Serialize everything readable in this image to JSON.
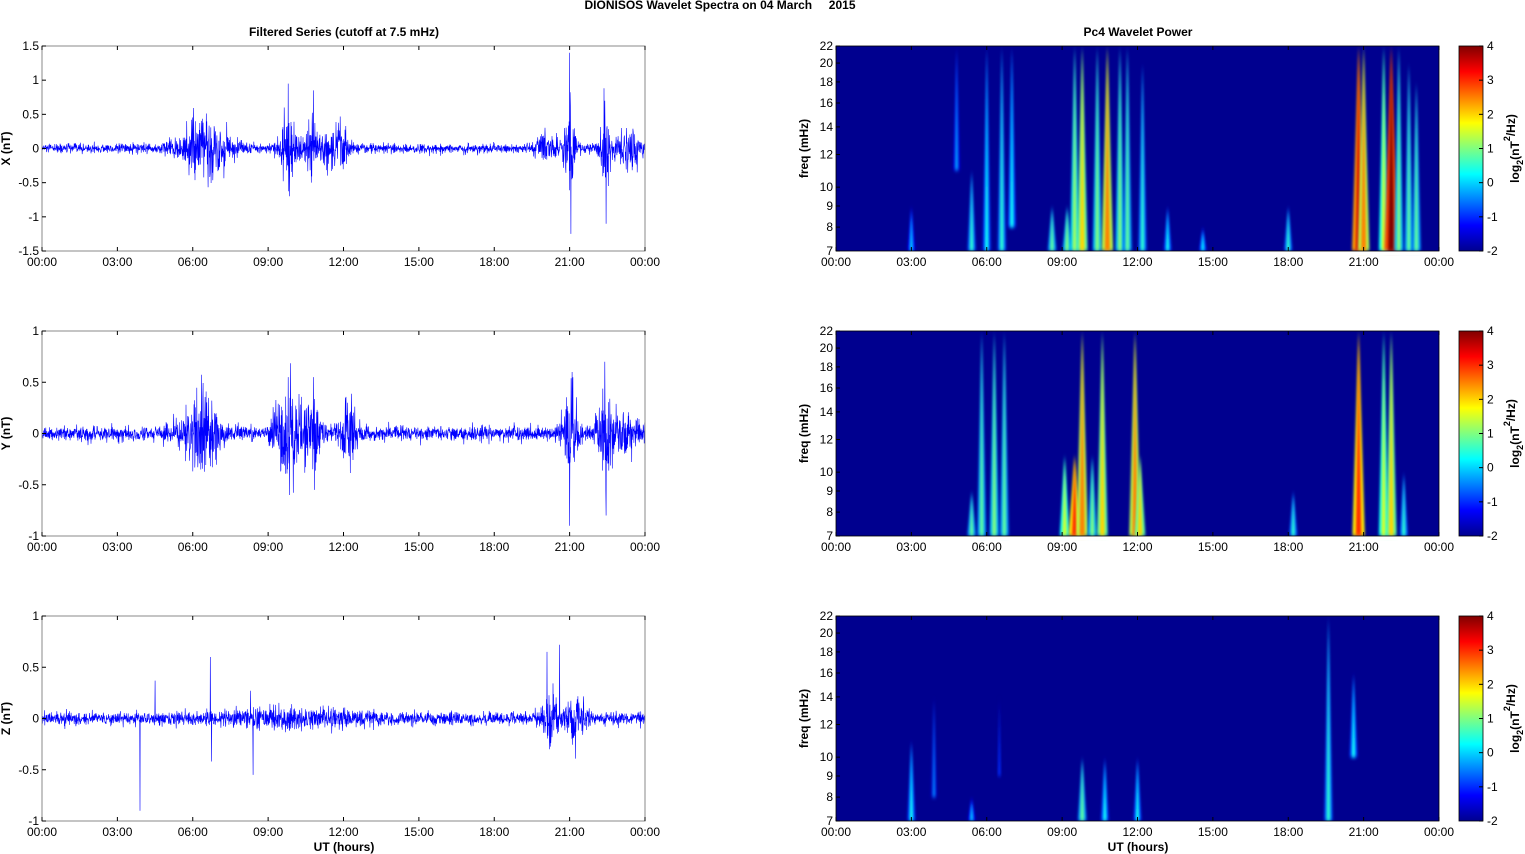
{
  "figure_title": "DIONISOS Wavelet Spectra on 04 March     2015",
  "left_title": "Filtered Series (cutoff at 7.5 mHz)",
  "right_title": "Pc4 Wavelet Power",
  "xlabel": "UT (hours)",
  "colors": {
    "series": "#0000ff",
    "background_power": "#00008f"
  },
  "chart_data": [
    {
      "type": "line",
      "component": "X",
      "ylabel": "X (nT)",
      "ylim": [
        -1.5,
        1.5
      ],
      "yticks": [
        "1.5",
        "1",
        "0.5",
        "0",
        "-0.5",
        "-1",
        "-1.5"
      ],
      "xticks": [
        "00:00",
        "03:00",
        "06:00",
        "09:00",
        "12:00",
        "15:00",
        "18:00",
        "21:00",
        "00:00"
      ],
      "xlim_hours": [
        0,
        24
      ],
      "noise_level": 0.035,
      "bursts": [
        [
          6.5,
          0.2,
          1.0
        ],
        [
          9.8,
          0.3,
          0.3
        ],
        [
          10.8,
          0.15,
          0.5
        ],
        [
          11.8,
          0.18,
          0.4
        ],
        [
          20.1,
          0.1,
          0.5
        ],
        [
          21.0,
          0.35,
          0.2
        ],
        [
          22.4,
          0.3,
          0.2
        ],
        [
          23.3,
          0.15,
          0.5
        ]
      ],
      "spikes": [
        [
          9.8,
          0.95
        ],
        [
          9.85,
          -0.7
        ],
        [
          10.8,
          0.85
        ],
        [
          21.0,
          1.4
        ],
        [
          21.05,
          -1.25
        ],
        [
          22.4,
          0.7
        ],
        [
          22.45,
          -1.1
        ],
        [
          6.1,
          0.4
        ]
      ]
    },
    {
      "type": "line",
      "component": "Y",
      "ylabel": "Y (nT)",
      "ylim": [
        -1,
        1
      ],
      "yticks": [
        "1",
        "0.5",
        "0",
        "-0.5",
        "-1"
      ],
      "xticks": [
        "00:00",
        "03:00",
        "06:00",
        "09:00",
        "12:00",
        "15:00",
        "18:00",
        "21:00",
        "00:00"
      ],
      "xlim_hours": [
        0,
        24
      ],
      "noise_level": 0.035,
      "bursts": [
        [
          6.3,
          0.2,
          0.7
        ],
        [
          9.8,
          0.25,
          0.5
        ],
        [
          10.8,
          0.22,
          0.3
        ],
        [
          12.2,
          0.18,
          0.3
        ],
        [
          21.0,
          0.2,
          0.3
        ],
        [
          22.4,
          0.2,
          0.3
        ],
        [
          23.2,
          0.08,
          0.6
        ]
      ],
      "spikes": [
        [
          9.8,
          0.55
        ],
        [
          9.85,
          -0.6
        ],
        [
          10.8,
          0.55
        ],
        [
          10.85,
          -0.55
        ],
        [
          21.0,
          -0.9
        ],
        [
          21.1,
          0.6
        ],
        [
          22.4,
          0.7
        ],
        [
          22.45,
          -0.8
        ]
      ]
    },
    {
      "type": "line",
      "component": "Z",
      "ylabel": "Z (nT)",
      "ylim": [
        -1,
        1
      ],
      "yticks": [
        "1",
        "0.5",
        "0",
        "-0.5",
        "-1"
      ],
      "xticks": [
        "00:00",
        "03:00",
        "06:00",
        "09:00",
        "12:00",
        "15:00",
        "18:00",
        "21:00",
        "00:00"
      ],
      "xlim_hours": [
        0,
        24
      ],
      "noise_level": 0.03,
      "bursts": [
        [
          20.2,
          0.12,
          0.3
        ],
        [
          21.2,
          0.1,
          0.4
        ],
        [
          10,
          0.03,
          3
        ]
      ],
      "spikes": [
        [
          3.9,
          -0.9
        ],
        [
          4.5,
          0.37
        ],
        [
          6.7,
          0.6
        ],
        [
          6.75,
          -0.42
        ],
        [
          8.4,
          -0.55
        ],
        [
          8.3,
          0.27
        ],
        [
          20.1,
          0.65
        ],
        [
          20.6,
          0.72
        ],
        [
          20.2,
          -0.3
        ]
      ]
    },
    {
      "type": "heatmap",
      "component": "X",
      "ylabel": "freq (mHz)",
      "ylim_mHz": [
        7,
        22
      ],
      "yscale": "log",
      "yticks": [
        "7",
        "8",
        "9",
        "10",
        "12",
        "14",
        "16",
        "18",
        "20",
        "22"
      ],
      "xticks": [
        "00:00",
        "03:00",
        "06:00",
        "09:00",
        "12:00",
        "15:00",
        "18:00",
        "21:00",
        "00:00"
      ],
      "colorbar": {
        "label": "log2(nT^2/Hz)",
        "range": [
          -2,
          4
        ],
        "ticks": [
          "4",
          "3",
          "2",
          "1",
          "0",
          "-1",
          "-2"
        ]
      },
      "streaks_hour_flo_fhi_power": [
        [
          3.0,
          7,
          9,
          0
        ],
        [
          4.8,
          11,
          22,
          -0.3
        ],
        [
          5.4,
          7,
          11,
          0.5
        ],
        [
          6.0,
          7,
          22,
          0.3
        ],
        [
          6.6,
          7,
          22,
          0.5
        ],
        [
          7.0,
          8,
          22,
          0.3
        ],
        [
          8.6,
          7,
          9,
          0.8
        ],
        [
          9.2,
          7,
          9,
          1
        ],
        [
          9.5,
          7,
          22,
          1.2
        ],
        [
          9.8,
          7,
          22,
          2
        ],
        [
          10.4,
          7,
          22,
          1
        ],
        [
          10.8,
          7,
          22,
          2.5
        ],
        [
          11.3,
          7,
          22,
          1
        ],
        [
          11.6,
          7,
          22,
          0.8
        ],
        [
          12.2,
          7,
          20,
          0.5
        ],
        [
          13.2,
          7,
          9,
          0.3
        ],
        [
          14.6,
          7,
          8,
          0.2
        ],
        [
          18.0,
          7,
          9,
          0.5
        ],
        [
          20.8,
          7,
          22,
          3.5
        ],
        [
          21.0,
          7,
          22,
          2.5
        ],
        [
          21.8,
          7,
          22,
          1.5
        ],
        [
          22.1,
          7,
          22,
          4
        ],
        [
          22.4,
          7,
          22,
          1
        ],
        [
          22.8,
          7,
          20,
          0.8
        ],
        [
          23.1,
          7,
          18,
          0.8
        ]
      ]
    },
    {
      "type": "heatmap",
      "component": "Y",
      "ylabel": "freq (mHz)",
      "ylim_mHz": [
        7,
        22
      ],
      "yscale": "log",
      "yticks": [
        "7",
        "8",
        "9",
        "10",
        "12",
        "14",
        "16",
        "18",
        "20",
        "22"
      ],
      "xticks": [
        "00:00",
        "03:00",
        "06:00",
        "09:00",
        "12:00",
        "15:00",
        "18:00",
        "21:00",
        "00:00"
      ],
      "colorbar": {
        "label": "log2(nT^2/Hz)",
        "range": [
          -2,
          4
        ],
        "ticks": [
          "4",
          "3",
          "2",
          "1",
          "0",
          "-1",
          "-2"
        ]
      },
      "streaks_hour_flo_fhi_power": [
        [
          5.4,
          7,
          9,
          0.8
        ],
        [
          5.8,
          7,
          22,
          0.8
        ],
        [
          6.3,
          7,
          22,
          1
        ],
        [
          6.7,
          7,
          22,
          0.8
        ],
        [
          9.1,
          7,
          11,
          1.5
        ],
        [
          9.5,
          7,
          11,
          3
        ],
        [
          9.8,
          7,
          22,
          2.5
        ],
        [
          10.2,
          7,
          11,
          1
        ],
        [
          10.6,
          7,
          22,
          2
        ],
        [
          11.9,
          7,
          22,
          2.5
        ],
        [
          12.1,
          7,
          11,
          2
        ],
        [
          18.2,
          7,
          9,
          0.5
        ],
        [
          20.8,
          7,
          22,
          3
        ],
        [
          21.8,
          7,
          22,
          1.5
        ],
        [
          22.1,
          7,
          22,
          2
        ],
        [
          22.6,
          7,
          10,
          0.5
        ]
      ]
    },
    {
      "type": "heatmap",
      "component": "Z",
      "ylabel": "freq (mHz)",
      "ylim_mHz": [
        7,
        22
      ],
      "yscale": "log",
      "yticks": [
        "7",
        "8",
        "9",
        "10",
        "12",
        "14",
        "16",
        "18",
        "20",
        "22"
      ],
      "xticks": [
        "00:00",
        "03:00",
        "06:00",
        "09:00",
        "12:00",
        "15:00",
        "18:00",
        "21:00",
        "00:00"
      ],
      "colorbar": {
        "label": "log2(nT^2/Hz)",
        "range": [
          -2,
          4
        ],
        "ticks": [
          "4",
          "3",
          "2",
          "1",
          "0",
          "-1",
          "-2"
        ]
      },
      "streaks_hour_flo_fhi_power": [
        [
          3.0,
          7,
          11,
          0.3
        ],
        [
          3.9,
          8,
          14,
          -0.5
        ],
        [
          5.4,
          7,
          8,
          0
        ],
        [
          6.5,
          9,
          14,
          -1
        ],
        [
          9.8,
          7,
          10,
          0.8
        ],
        [
          10.7,
          7,
          10,
          0.3
        ],
        [
          12.0,
          7,
          10,
          0.3
        ],
        [
          19.6,
          7,
          22,
          0.5
        ],
        [
          20.6,
          10,
          16,
          0.3
        ]
      ]
    }
  ]
}
